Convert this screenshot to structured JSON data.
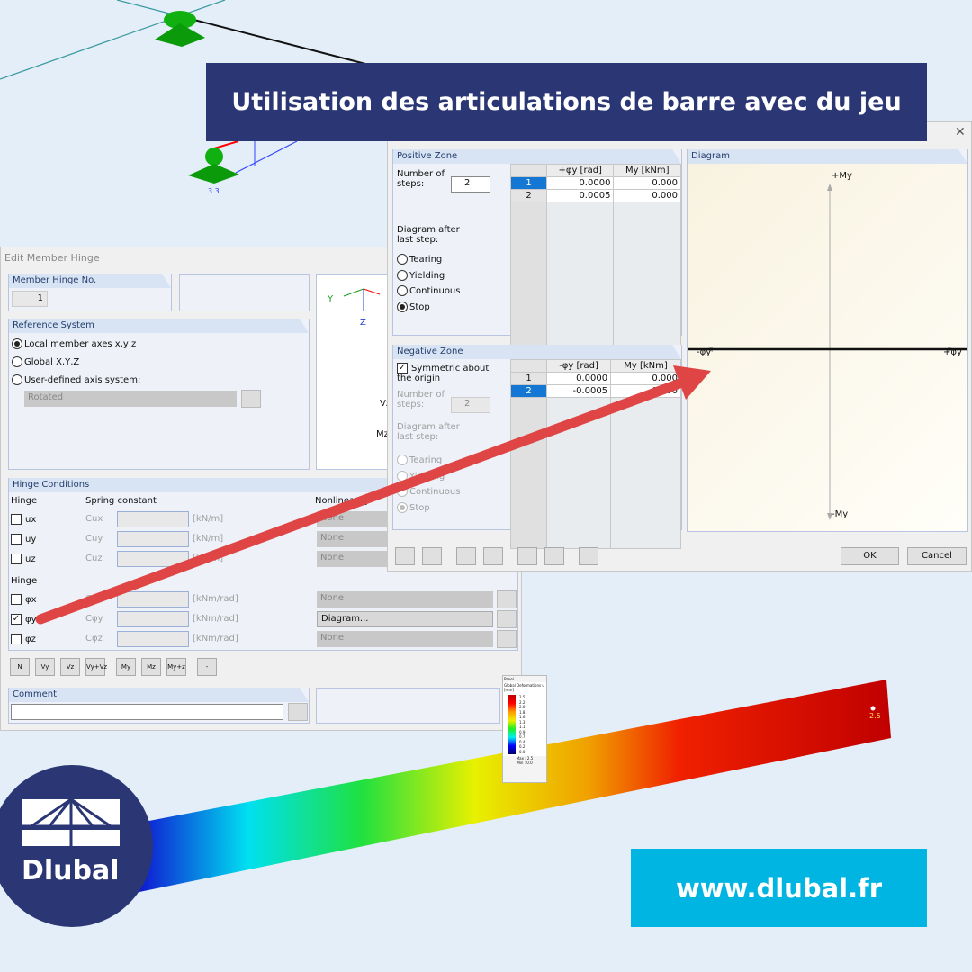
{
  "banner": {
    "title": "Utilisation des articulations de barre avec du jeu"
  },
  "website": {
    "url": "www.dlubal.fr"
  },
  "logo": {
    "text": "Dlubal"
  },
  "model": {
    "support_label": "3.3",
    "node_value": "2.5"
  },
  "hinge_dialog": {
    "title": "Edit Member Hinge",
    "member_hinge_no": {
      "label": "Member Hinge No.",
      "value": "1"
    },
    "reference_system": {
      "label": "Reference System",
      "options": [
        "Local member axes x,y,z",
        "Global X,Y,Z",
        "User-defined axis system:"
      ],
      "selected": 0,
      "axis_select": "Rotated"
    },
    "preview_axes": {
      "y": "Y",
      "z": "Z",
      "vz": "Vz",
      "mz": "Mz"
    },
    "hinge_conditions": {
      "label": "Hinge Conditions",
      "col_hinge": "Hinge",
      "col_spring": "Spring constant",
      "col_nonlinear": "Nonlinearity",
      "translations": [
        {
          "name": "ux",
          "checked": false,
          "spring": "Cux",
          "unit": "[kN/m]",
          "nonlinear": "None"
        },
        {
          "name": "uy",
          "checked": false,
          "spring": "Cuy",
          "unit": "[kN/m]",
          "nonlinear": "None"
        },
        {
          "name": "uz",
          "checked": false,
          "spring": "Cuz",
          "unit": "[kN/m]",
          "nonlinear": "None"
        }
      ],
      "rotations_label": "Hinge",
      "rotations": [
        {
          "name": "φx",
          "checked": false,
          "spring": "Cφx",
          "unit": "[kNm/rad]",
          "nonlinear": "None"
        },
        {
          "name": "φy",
          "checked": true,
          "spring": "Cφy",
          "unit": "[kNm/rad]",
          "nonlinear": "Diagram..."
        },
        {
          "name": "φz",
          "checked": false,
          "spring": "Cφz",
          "unit": "[kNm/rad]",
          "nonlinear": "None"
        }
      ]
    },
    "toolbar": [
      "N",
      "Vy",
      "Vz",
      "Vy+Vz",
      "My",
      "Mz",
      "My+z",
      "-"
    ],
    "comment": {
      "label": "Comment",
      "value": ""
    }
  },
  "diagram_dialog": {
    "positive_zone": {
      "label": "Positive Zone",
      "steps_label": "Number of steps:",
      "steps": "2",
      "after_label": "Diagram after last step:",
      "options": [
        "Tearing",
        "Yielding",
        "Continuous",
        "Stop"
      ],
      "selected": 3,
      "columns": [
        "+φy [rad]",
        "My [kNm]"
      ],
      "rows": [
        [
          "1",
          "0.0000",
          "0.000"
        ],
        [
          "2",
          "0.0005",
          "0.000"
        ]
      ]
    },
    "negative_zone": {
      "label": "Negative Zone",
      "symmetric_label": "Symmetric about the origin",
      "symmetric": true,
      "steps_label": "Number of steps:",
      "steps": "2",
      "after_label": "Diagram after last step:",
      "options": [
        "Tearing",
        "Yielding",
        "Continuous",
        "Stop"
      ],
      "selected": 3,
      "columns": [
        "-φy [rad]",
        "My [kNm]"
      ],
      "rows": [
        [
          "1",
          "0.0000",
          "0.000"
        ],
        [
          "2",
          "-0.0005",
          "0.000"
        ]
      ]
    },
    "diagram": {
      "label": "Diagram",
      "axis_top": "+My",
      "axis_bottom": "-My",
      "axis_left": "-φy",
      "axis_right": "+φy"
    },
    "ok": "OK",
    "cancel": "Cancel",
    "tools": [
      "help-icon",
      "decimal-icon",
      "open-icon",
      "save-icon",
      "excel-export-icon",
      "excel-import-icon",
      "calculator-icon"
    ]
  },
  "panel": {
    "title": "Panel",
    "subtitle": "Global Deformations u [mm]",
    "scale": [
      "2.5",
      "2.2",
      "2.0",
      "1.8",
      "1.6",
      "1.3",
      "1.1",
      "0.9",
      "0.7",
      "0.4",
      "0.2",
      "0.0"
    ],
    "max": "Max : 2.5",
    "min": "Min : 0.0"
  },
  "colors": {
    "banner": "#2b3674",
    "url_box": "#00b5e2",
    "arrow": "#e04040",
    "accent_select": "#1477d4"
  }
}
